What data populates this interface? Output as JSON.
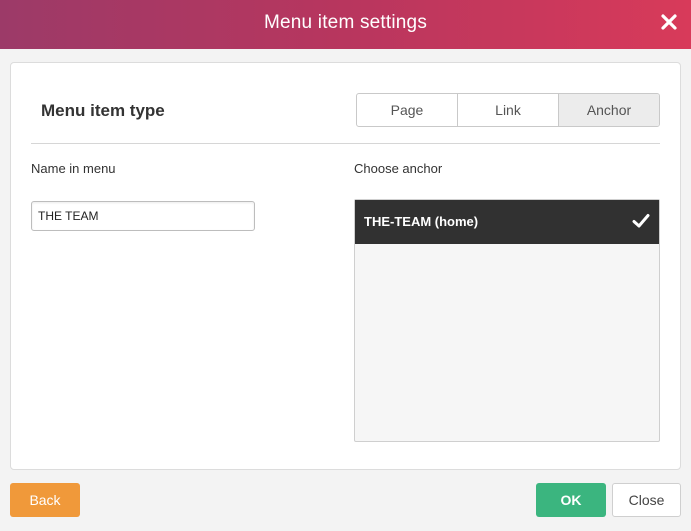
{
  "dialog": {
    "title": "Menu item settings"
  },
  "type_section": {
    "heading": "Menu item type",
    "options": [
      "Page",
      "Link",
      "Anchor"
    ],
    "selected": "Anchor"
  },
  "name_field": {
    "label": "Name in menu",
    "value": "THE TEAM"
  },
  "anchor_section": {
    "label": "Choose anchor",
    "items": [
      {
        "label": "THE-TEAM (home)",
        "selected": true
      }
    ]
  },
  "footer": {
    "back_label": "Back",
    "ok_label": "OK",
    "close_label": "Close"
  },
  "colors": {
    "title_gradient_start": "#9c3a68",
    "title_gradient_end": "#d83a5a",
    "back_button": "#f0993a",
    "ok_button": "#3bb57f",
    "selected_anchor_bg": "#313131"
  },
  "icons": {
    "close": "close-icon",
    "selected_check": "checkmark-icon"
  }
}
